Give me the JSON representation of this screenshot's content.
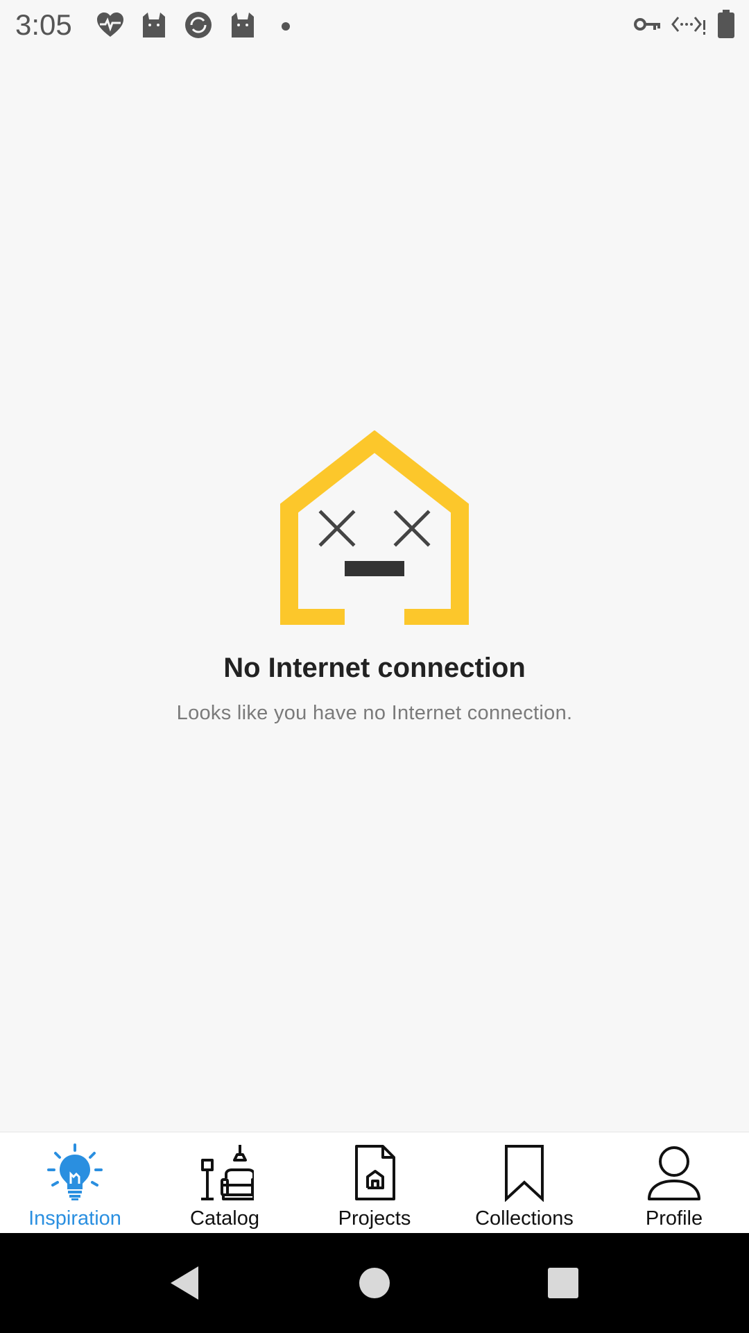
{
  "status_bar": {
    "time": "3:05",
    "icons_left": [
      "heart-pulse-icon",
      "cat-icon",
      "sync-badge-icon",
      "cat-icon",
      "dot-icon"
    ],
    "icons_right": [
      "vpn-key-icon",
      "data-saver-icon",
      "battery-icon"
    ]
  },
  "empty_state": {
    "title": "No Internet connection",
    "subtitle": "Looks like you have no Internet connection.",
    "illustration": "dead-house-icon",
    "accent_color": "#fcc72b"
  },
  "bottom_nav": {
    "active_color": "#2a8fe0",
    "items": [
      {
        "label": "Inspiration",
        "icon": "lightbulb-icon",
        "active": true
      },
      {
        "label": "Catalog",
        "icon": "furniture-icon",
        "active": false
      },
      {
        "label": "Projects",
        "icon": "house-document-icon",
        "active": false
      },
      {
        "label": "Collections",
        "icon": "bookmark-icon",
        "active": false
      },
      {
        "label": "Profile",
        "icon": "person-icon",
        "active": false
      }
    ]
  },
  "system_nav": {
    "buttons": [
      "back-icon",
      "home-icon",
      "recents-icon"
    ]
  }
}
